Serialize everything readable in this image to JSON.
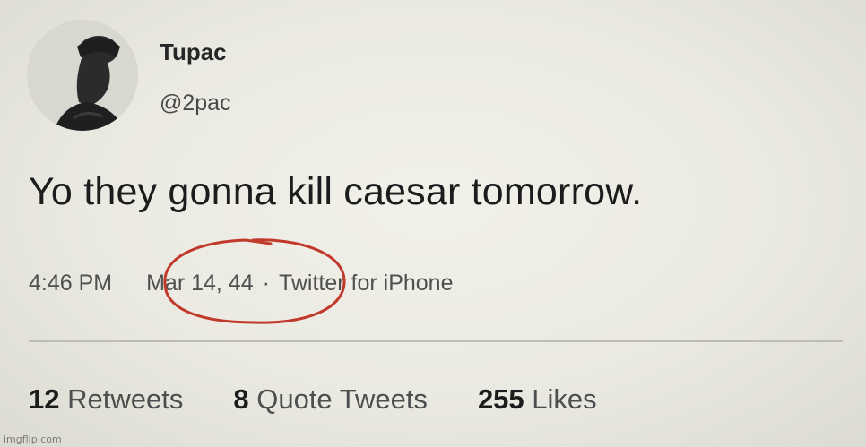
{
  "tweet": {
    "display_name": "Tupac",
    "handle": "@2pac",
    "text": "Yo they gonna kill caesar tomorrow.",
    "time": "4:46 PM",
    "date": "Mar 14, 44",
    "separator": "·",
    "source": "Twitter for iPhone",
    "avatar_icon": "profile-photo",
    "date_highlight_color": "#c0392b"
  },
  "stats": {
    "retweets_count": "12",
    "retweets_label": "Retweets",
    "quotes_count": "8",
    "quotes_label": "Quote Tweets",
    "likes_count": "255",
    "likes_label": "Likes"
  },
  "watermark": "imgflip.com"
}
